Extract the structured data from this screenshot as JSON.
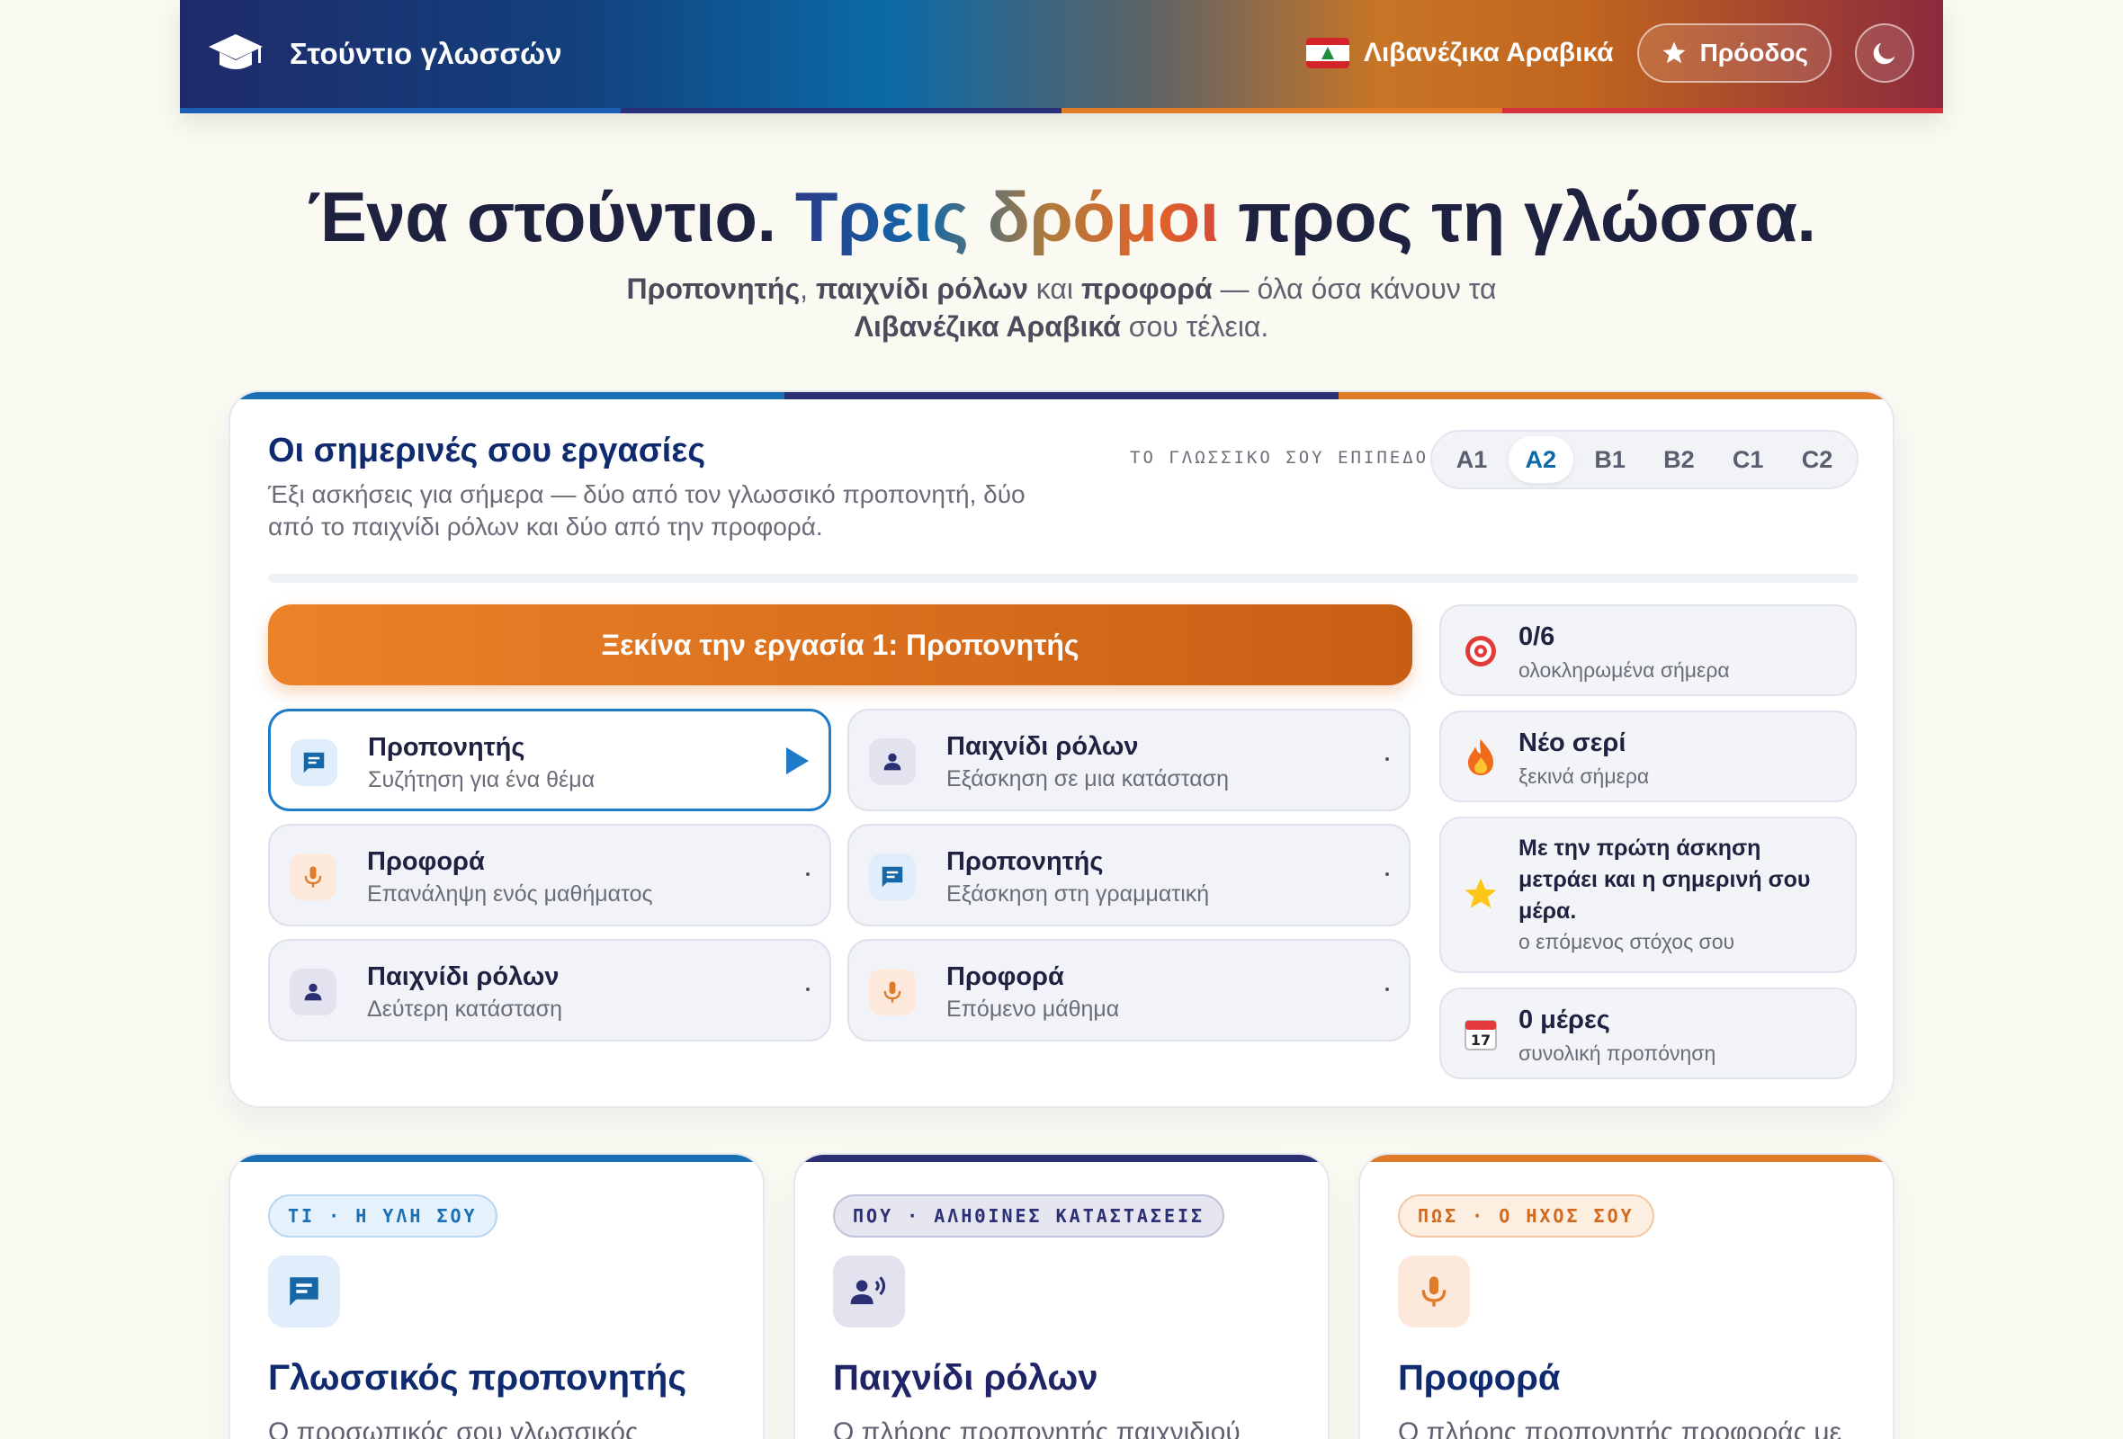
{
  "header": {
    "brand": "Στούντιο γλωσσών",
    "language": "Λιβανέζικα Αραβικά",
    "progress_label": "Πρόοδος",
    "stripe_colors": [
      "#1a5fb4",
      "#2a2f7a",
      "#e07b2a",
      "#d5323f"
    ]
  },
  "hero": {
    "title_pre": "Ένα στούντιο.",
    "title_accent": "Τρεις δρόμοι",
    "title_post": "προς τη γλώσσα.",
    "sub_w1": "Προπονητής",
    "sub_c1": ",",
    "sub_w2": "παιχνίδι ρόλων",
    "sub_c2": "και",
    "sub_w3": "προφορά",
    "sub_c3": "— όλα όσα κάνουν τα",
    "sub_w4": "Λιβανέζικα Αραβικά",
    "sub_c4": "σου τέλεια."
  },
  "tasks": {
    "title": "Οι σημερινές σου εργασίες",
    "description": "Έξι ασκήσεις για σήμερα — δύο από τον γλωσσικό προπονητή, δύο από το παιχνίδι ρόλων και δύο από την προφορά.",
    "level_label": "ΤΟ ΓΛΩΣΣΙΚΟ ΣΟΥ ΕΠΙΠΕΔΟ",
    "levels": [
      "A1",
      "A2",
      "B1",
      "B2",
      "C1",
      "C2"
    ],
    "selected_level": "A2",
    "start_button": "Ξεκίνα την εργασία 1: Προπονητής",
    "items": [
      {
        "title": "Προπονητής",
        "subtitle": "Συζήτηση για ένα θέμα",
        "icon": "chat-icon",
        "active": true
      },
      {
        "title": "Παιχνίδι ρόλων",
        "subtitle": "Εξάσκηση σε μια κατάσταση",
        "icon": "person-icon"
      },
      {
        "title": "Προφορά",
        "subtitle": "Επανάληψη ενός μαθήματος",
        "icon": "microphone-icon"
      },
      {
        "title": "Προπονητής",
        "subtitle": "Εξάσκηση στη γραμματική",
        "icon": "chat-icon"
      },
      {
        "title": "Παιχνίδι ρόλων",
        "subtitle": "Δεύτερη κατάσταση",
        "icon": "person-icon"
      },
      {
        "title": "Προφορά",
        "subtitle": "Επόμενο μάθημα",
        "icon": "microphone-icon"
      }
    ],
    "stats": [
      {
        "value": "0/6",
        "label": "ολοκληρωμένα σήμερα",
        "icon": "target-icon"
      },
      {
        "value": "Νέο σερί",
        "label": "ξεκινά σήμερα",
        "icon": "fire-icon"
      },
      {
        "value": "Με την πρώτη άσκηση μετράει και η σημερινή σου μέρα.",
        "label": "ο επόμενος στόχος σου",
        "icon": "star-icon"
      },
      {
        "value": "0 μέρες",
        "label": "συνολική προπόνηση",
        "icon": "calendar-icon"
      }
    ]
  },
  "features": [
    {
      "tag": "ΤΙ · Η ΥΛΗ ΣΟΥ",
      "title": "Γλωσσικός προπονητής",
      "desc": "Ο προσωπικός σου γλωσσικός",
      "icon": "chat-icon",
      "color": "#1a6fb5"
    },
    {
      "tag": "ΠΟΥ · ΑΛΗΘΙΝΕΣ ΚΑΤΑΣΤΑΣΕΙΣ",
      "title": "Παιχνίδι ρόλων",
      "desc": "Ο πλήρης προπονητής παιχνιδιού",
      "icon": "voice-person-icon",
      "color": "#2b2f74"
    },
    {
      "tag": "ΠΩΣ · Ο ΗΧΟΣ ΣΟΥ",
      "title": "Προφορά",
      "desc": "Ο πλήρης προπονητής προφοράς με",
      "icon": "microphone-icon",
      "color": "#e07b2a"
    }
  ]
}
